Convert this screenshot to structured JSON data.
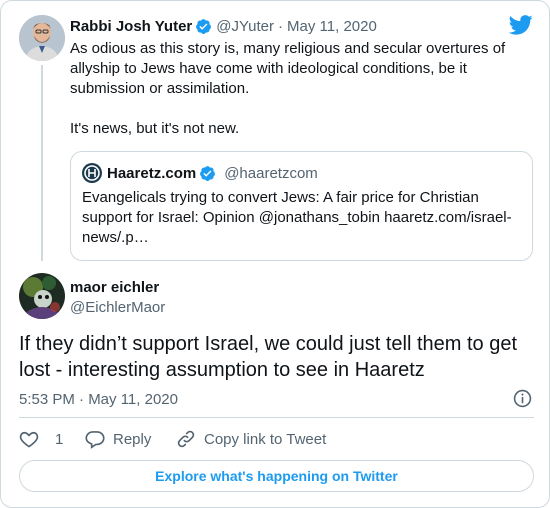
{
  "first_tweet": {
    "display_name": "Rabbi Josh Yuter",
    "handle": "@JYuter",
    "separator": "·",
    "date": "May 11, 2020",
    "text_line1": "As odious as this story is, many religious and secular overtures of",
    "text_line2": "allyship to Jews have come with ideological conditions, be it",
    "text_line3": "submission or assimilation.",
    "text_line4": "It's news, but it's not new."
  },
  "quoted": {
    "display_name": "Haaretz.com",
    "handle": "@haaretzcom",
    "line1": "Evangelicals trying to convert Jews: A fair price for Christian",
    "line2": "support for Israel: Opinion @jonathans_tobin haaretz.com/israel-",
    "line3": "news/.p…"
  },
  "main_tweet": {
    "display_name": "maor eichler",
    "handle": "@EichlerMaor",
    "text_line1": "If they didn’t support Israel, we could just tell them to get",
    "text_line2": "lost - interesting assumption to see in Haaretz",
    "timestamp": "5:53 PM · May 11, 2020"
  },
  "actions": {
    "like_count": "1",
    "reply_label": "Reply",
    "copy_link_label": "Copy link to Tweet"
  },
  "explore_label": "Explore what's happening on Twitter",
  "colors": {
    "twitter_blue": "#1d9bf0",
    "text": "#0f1419",
    "muted": "#536471",
    "border": "#cfd9de"
  },
  "icons": [
    "twitter-bird-icon",
    "verified-badge-icon",
    "info-icon",
    "heart-icon",
    "reply-icon",
    "link-icon"
  ]
}
